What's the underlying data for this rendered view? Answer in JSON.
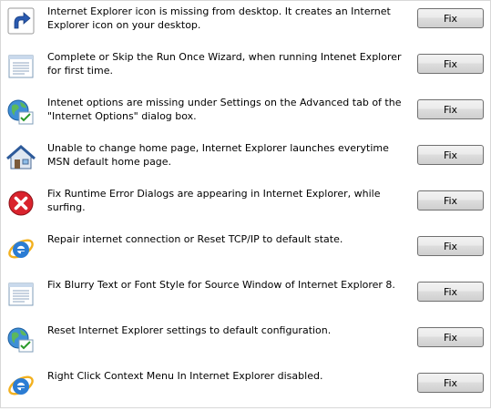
{
  "button_label": "Fix",
  "items": [
    {
      "icon": "shortcut-arrow-icon",
      "text": "Internet Explorer icon is missing from desktop. It creates an Internet Explorer icon on your desktop."
    },
    {
      "icon": "document-window-icon",
      "text": "Complete or Skip the Run Once Wizard, when running Intenet Explorer for first time."
    },
    {
      "icon": "internet-options-globe-icon",
      "text": "Intenet options are missing under Settings on the Advanced tab of the \"Internet Options\" dialog box."
    },
    {
      "icon": "home-icon",
      "text": "Unable to change home page, Internet Explorer launches everytime MSN default home page."
    },
    {
      "icon": "error-icon",
      "text": "Fix Runtime Error Dialogs are appearing in Internet Explorer, while surfing."
    },
    {
      "icon": "internet-explorer-icon",
      "text": "Repair internet connection or Reset TCP/IP to default state."
    },
    {
      "icon": "document-window-icon",
      "text": "Fix Blurry Text or Font Style for Source Window of Internet Explorer 8."
    },
    {
      "icon": "internet-options-globe-icon",
      "text": "Reset Internet Explorer settings to default configuration."
    },
    {
      "icon": "internet-explorer-icon",
      "text": "Right Click Context Menu In Internet Explorer disabled."
    }
  ]
}
